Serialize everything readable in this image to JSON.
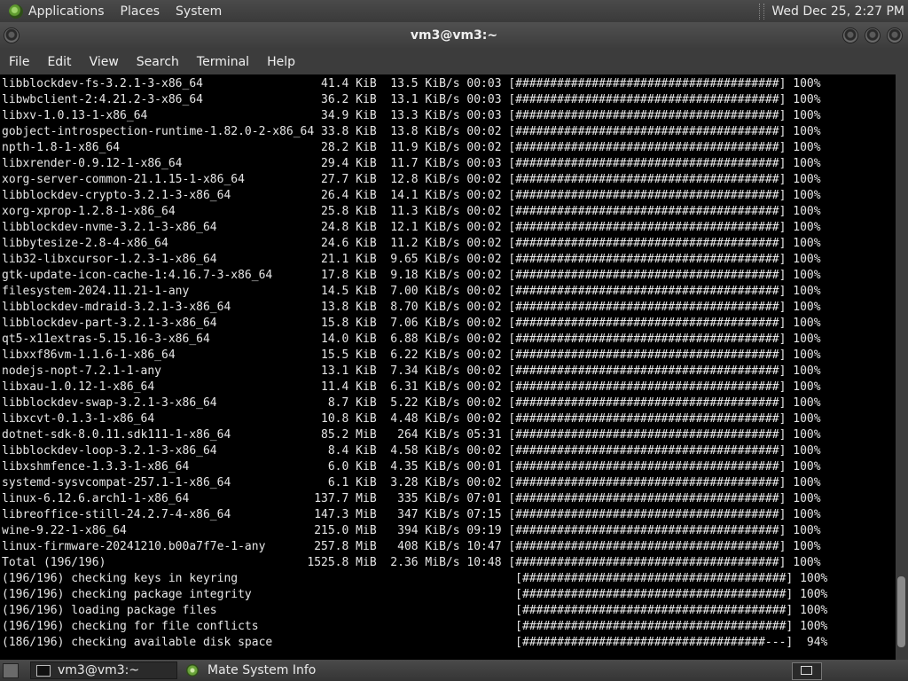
{
  "top_panel": {
    "menus": [
      "Applications",
      "Places",
      "System"
    ],
    "clock": "Wed Dec 25,  2:27 PM"
  },
  "window": {
    "title": "vm3@vm3:~"
  },
  "menubar": [
    "File",
    "Edit",
    "View",
    "Search",
    "Terminal",
    "Help"
  ],
  "terminal_lines": [
    "libblockdev-fs-3.2.1-3-x86_64                 41.4 KiB  13.5 KiB/s 00:03 [######################################] 100%",
    "libwbclient-2:4.21.2-3-x86_64                 36.2 KiB  13.1 KiB/s 00:03 [######################################] 100%",
    "libxv-1.0.13-1-x86_64                         34.9 KiB  13.3 KiB/s 00:03 [######################################] 100%",
    "gobject-introspection-runtime-1.82.0-2-x86_64 33.8 KiB  13.8 KiB/s 00:02 [######################################] 100%",
    "npth-1.8-1-x86_64                             28.2 KiB  11.9 KiB/s 00:02 [######################################] 100%",
    "libxrender-0.9.12-1-x86_64                    29.4 KiB  11.7 KiB/s 00:03 [######################################] 100%",
    "xorg-server-common-21.1.15-1-x86_64           27.7 KiB  12.8 KiB/s 00:02 [######################################] 100%",
    "libblockdev-crypto-3.2.1-3-x86_64             26.4 KiB  14.1 KiB/s 00:02 [######################################] 100%",
    "xorg-xprop-1.2.8-1-x86_64                     25.8 KiB  11.3 KiB/s 00:02 [######################################] 100%",
    "libblockdev-nvme-3.2.1-3-x86_64               24.8 KiB  12.1 KiB/s 00:02 [######################################] 100%",
    "libbytesize-2.8-4-x86_64                      24.6 KiB  11.2 KiB/s 00:02 [######################################] 100%",
    "lib32-libxcursor-1.2.3-1-x86_64               21.1 KiB  9.65 KiB/s 00:02 [######################################] 100%",
    "gtk-update-icon-cache-1:4.16.7-3-x86_64       17.8 KiB  9.18 KiB/s 00:02 [######################################] 100%",
    "filesystem-2024.11.21-1-any                   14.5 KiB  7.00 KiB/s 00:02 [######################################] 100%",
    "libblockdev-mdraid-3.2.1-3-x86_64             13.8 KiB  8.70 KiB/s 00:02 [######################################] 100%",
    "libblockdev-part-3.2.1-3-x86_64               15.8 KiB  7.06 KiB/s 00:02 [######################################] 100%",
    "qt5-x11extras-5.15.16-3-x86_64                14.0 KiB  6.88 KiB/s 00:02 [######################################] 100%",
    "libxxf86vm-1.1.6-1-x86_64                     15.5 KiB  6.22 KiB/s 00:02 [######################################] 100%",
    "nodejs-nopt-7.2.1-1-any                       13.1 KiB  7.34 KiB/s 00:02 [######################################] 100%",
    "libxau-1.0.12-1-x86_64                        11.4 KiB  6.31 KiB/s 00:02 [######################################] 100%",
    "libblockdev-swap-3.2.1-3-x86_64                8.7 KiB  5.22 KiB/s 00:02 [######################################] 100%",
    "libxcvt-0.1.3-1-x86_64                        10.8 KiB  4.48 KiB/s 00:02 [######################################] 100%",
    "dotnet-sdk-8.0.11.sdk111-1-x86_64             85.2 MiB   264 KiB/s 05:31 [######################################] 100%",
    "libblockdev-loop-3.2.1-3-x86_64                8.4 KiB  4.58 KiB/s 00:02 [######################################] 100%",
    "libxshmfence-1.3.3-1-x86_64                    6.0 KiB  4.35 KiB/s 00:01 [######################################] 100%",
    "systemd-sysvcompat-257.1-1-x86_64              6.1 KiB  3.28 KiB/s 00:02 [######################################] 100%",
    "linux-6.12.6.arch1-1-x86_64                  137.7 MiB   335 KiB/s 07:01 [######################################] 100%",
    "libreoffice-still-24.2.7-4-x86_64            147.3 MiB   347 KiB/s 07:15 [######################################] 100%",
    "wine-9.22-1-x86_64                           215.0 MiB   394 KiB/s 09:19 [######################################] 100%",
    "linux-firmware-20241210.b00a7f7e-1-any       257.8 MiB   408 KiB/s 10:47 [######################################] 100%",
    "Total (196/196)                             1525.8 MiB  2.36 MiB/s 10:48 [######################################] 100%",
    "(196/196) checking keys in keyring                                        [######################################] 100%",
    "(196/196) checking package integrity                                      [######################################] 100%",
    "(196/196) loading package files                                           [######################################] 100%",
    "(196/196) checking for file conflicts                                     [######################################] 100%",
    "(186/196) checking available disk space                                   [###################################---]  94%"
  ],
  "taskbar": {
    "tasks": [
      "vm3@vm3:~",
      "Mate System Info"
    ]
  },
  "icons": {
    "menu_logo": "mate-logo-icon",
    "task_terminal": "terminal-icon",
    "task_info": "mate-info-icon",
    "desktop": "show-desktop-icon",
    "workspace": "workspace-switcher-icon"
  }
}
